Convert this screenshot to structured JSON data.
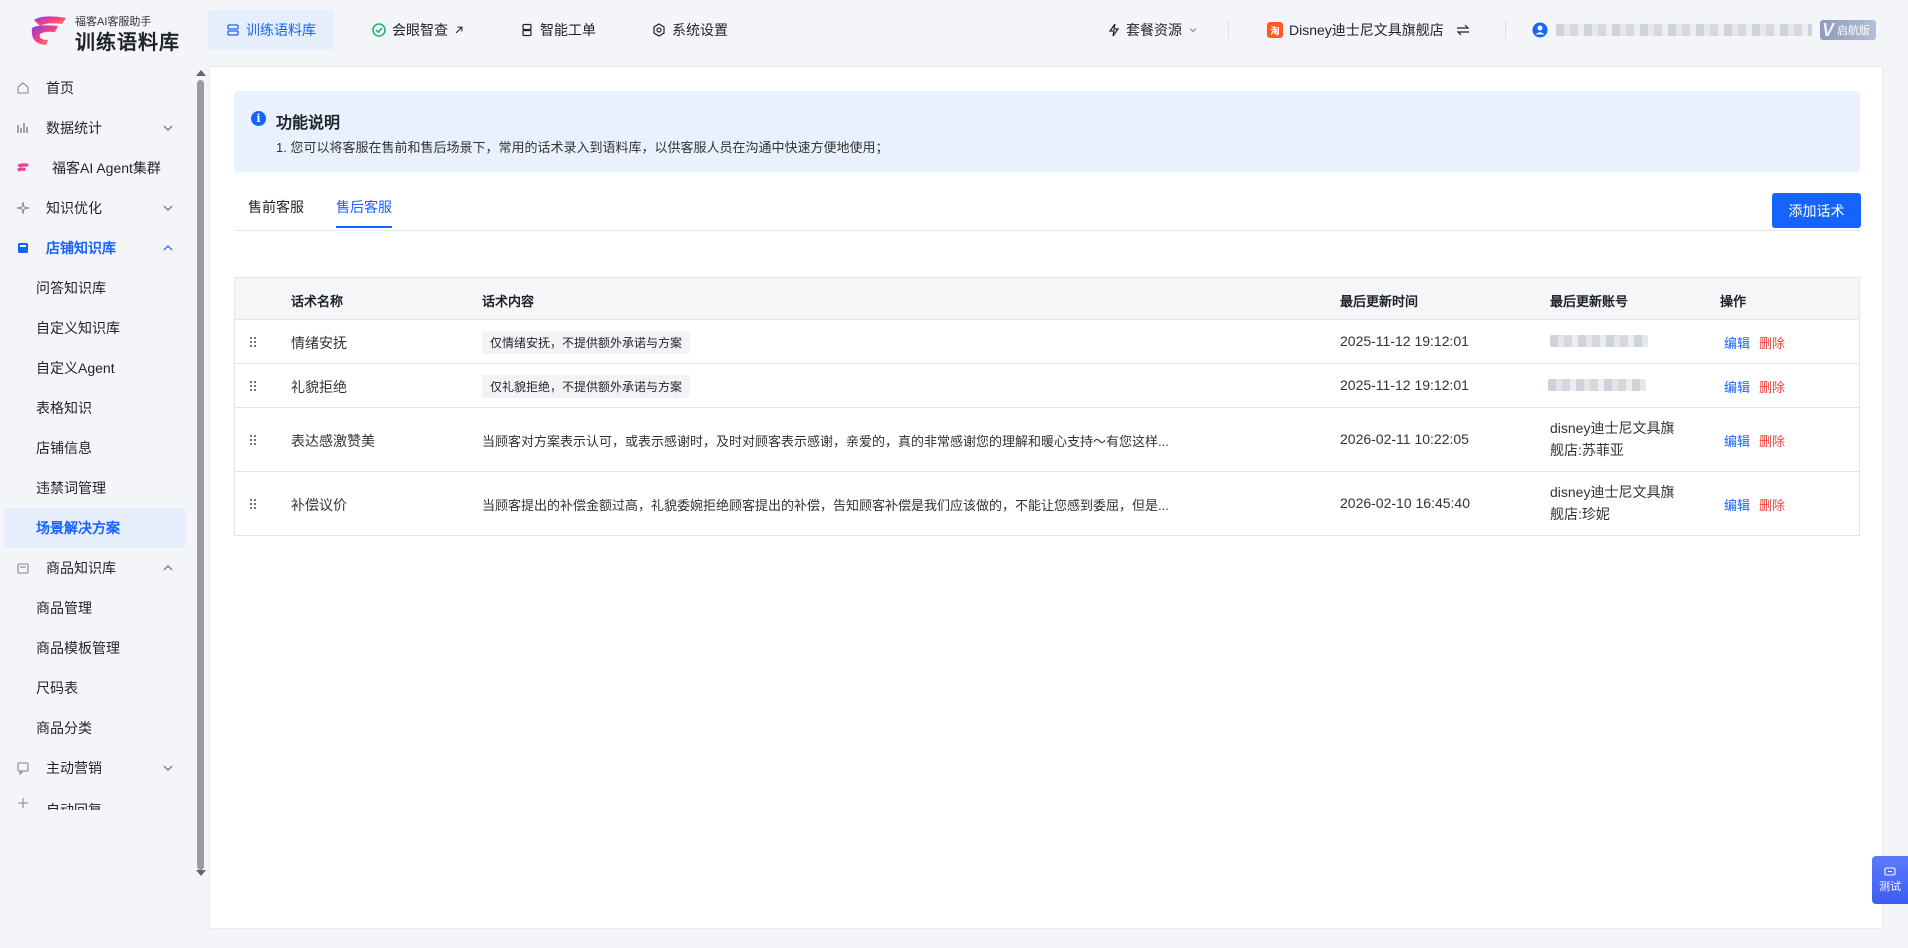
{
  "brand": {
    "subtitle": "福客AI客服助手",
    "title": "训练语料库"
  },
  "nav": [
    {
      "label": "训练语料库",
      "icon": "database-icon",
      "active": true
    },
    {
      "label": "会眼智查",
      "icon": "check-circle-icon",
      "active": false
    },
    {
      "label": "智能工单",
      "icon": "ticket-icon",
      "active": false
    },
    {
      "label": "系统设置",
      "icon": "gear-icon",
      "active": false
    }
  ],
  "header": {
    "package_label": "套餐资源",
    "shop_badge": "淘",
    "shop_name": "Disney迪士尼文具旗舰店",
    "vip_label": "启航版"
  },
  "sidebar": {
    "items": [
      {
        "label": "首页",
        "icon": "home-icon"
      },
      {
        "label": "数据统计",
        "icon": "bar-chart-icon"
      },
      {
        "label": "福客AI Agent集群",
        "icon": "brand-logo-icon"
      },
      {
        "label": "知识优化",
        "icon": "sparkle-icon"
      },
      {
        "label": "店铺知识库",
        "icon": "book-icon"
      },
      {
        "label": "问答知识库"
      },
      {
        "label": "自定义知识库"
      },
      {
        "label": "自定义Agent"
      },
      {
        "label": "表格知识"
      },
      {
        "label": "店铺信息"
      },
      {
        "label": "违禁词管理"
      },
      {
        "label": "场景解决方案"
      },
      {
        "label": "商品知识库",
        "icon": "box-icon"
      },
      {
        "label": "商品管理"
      },
      {
        "label": "商品模板管理"
      },
      {
        "label": "尺码表"
      },
      {
        "label": "商品分类"
      },
      {
        "label": "主动营销",
        "icon": "message-icon"
      },
      {
        "label": "自动回复",
        "icon": "reply-icon"
      }
    ]
  },
  "info": {
    "title": "功能说明",
    "desc": "1. 您可以将客服在售前和售后场景下，常用的话术录入到语料库，以供客服人员在沟通中快速方便地使用；"
  },
  "tabs": [
    {
      "label": "售前客服",
      "active": false
    },
    {
      "label": "售后客服",
      "active": true
    }
  ],
  "add_button": "添加话术",
  "table": {
    "headers": {
      "name": "话术名称",
      "content": "话术内容",
      "time": "最后更新时间",
      "account": "最后更新账号",
      "ops": "操作"
    },
    "rows": [
      {
        "name": "情绪安抚",
        "content": "仅情绪安抚，不提供额外承诺与方案",
        "time": "2025-11-12 19:12:01",
        "account_line1": "",
        "account_line2": "",
        "edit": "编辑",
        "delete": "删除"
      },
      {
        "name": "礼貌拒绝",
        "content": "仅礼貌拒绝，不提供额外承诺与方案",
        "time": "2025-11-12 19:12:01",
        "account_line1": "",
        "account_line2": "",
        "edit": "编辑",
        "delete": "删除"
      },
      {
        "name": "表达感激赞美",
        "content": "当顾客对方案表示认可，或表示感谢时，及时对顾客表示感谢，亲爱的，真的非常感谢您的理解和暖心支持～有您这样...",
        "time": "2026-02-11 10:22:05",
        "account_line1": "disney迪士尼文具旗",
        "account_line2": "舰店:苏菲亚",
        "edit": "编辑",
        "delete": "删除"
      },
      {
        "name": "补偿议价",
        "content": "当顾客提出的补偿金额过高，礼貌委婉拒绝顾客提出的补偿，告知顾客补偿是我们应该做的，不能让您感到委屈，但是...",
        "time": "2026-02-10 16:45:40",
        "account_line1": "disney迪士尼文具旗",
        "account_line2": "舰店:珍妮",
        "edit": "编辑",
        "delete": "删除"
      }
    ]
  },
  "float_button": {
    "label": "测试",
    "icon": "chat-icon"
  },
  "colors": {
    "accent": "#1664ff",
    "danger": "#f53f3f",
    "info_bg": "#e8f1fd"
  }
}
